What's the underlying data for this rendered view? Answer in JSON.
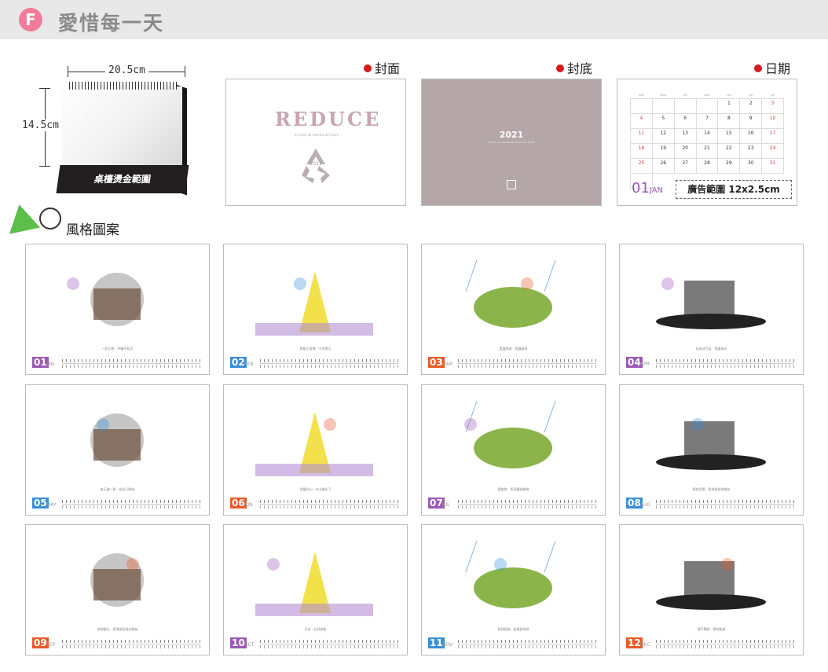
{
  "header": {
    "badge": "F",
    "title": "愛惜每一天"
  },
  "desk": {
    "width_label": "20.5cm",
    "height_label": "14.5cm",
    "base_label": "桌檯燙金範圍"
  },
  "sections": {
    "cover": "封面",
    "back": "封底",
    "date": "日期"
  },
  "cover": {
    "word": "REDUCE",
    "sub": "all days all months all years",
    "year": "2021"
  },
  "back": {
    "year": "2021",
    "line": "protect our planet earth our only home"
  },
  "date_page": {
    "weekdays": [
      "SUN",
      "MON",
      "TUE",
      "WED",
      "THU",
      "FRI",
      "SAT"
    ],
    "days": [
      "",
      "",
      "",
      "",
      "1",
      "2",
      "3",
      "4",
      "5",
      "6",
      "7",
      "8",
      "9",
      "10",
      "11",
      "12",
      "13",
      "14",
      "15",
      "16",
      "17",
      "18",
      "19",
      "20",
      "21",
      "22",
      "23",
      "24",
      "25",
      "26",
      "27",
      "28",
      "29",
      "30",
      "31",
      ""
    ],
    "month_num": "01",
    "month_name": "JAN",
    "ad_label": "廣告範圍 12x2.5cm"
  },
  "style_label": "風格圖案",
  "colors": {
    "accent_pink": "#f07b9a",
    "dot_red": "#d71920",
    "back_bg": "#b5a7a8",
    "tri_green": "#5bbf4a"
  },
  "months": [
    {
      "num": "01",
      "name": "JAN",
      "color": "#9b59b6",
      "caption": "一粒回收 · 杯罐不亂丟",
      "icon": "trash-pile-icon"
    },
    {
      "num": "02",
      "name": "FEB",
      "color": "#3a8fd6",
      "caption": "節能小習慣 · 不浪費水",
      "icon": "factory-tower-icon"
    },
    {
      "num": "03",
      "name": "MAR",
      "color": "#e85a2a",
      "caption": "愛護地球 · 愛護森林",
      "icon": "hill-rain-icon"
    },
    {
      "num": "04",
      "name": "APR",
      "color": "#9b59b6",
      "caption": "拒絕油污染 · 保護海洋",
      "icon": "oil-barrel-icon"
    },
    {
      "num": "05",
      "name": "MAY",
      "color": "#3a8fd6",
      "caption": "每天做一點 · 從自己開始",
      "icon": "faces-week-icon"
    },
    {
      "num": "06",
      "name": "JUN",
      "color": "#e85a2a",
      "caption": "保護冰山 · 冰山融化了",
      "icon": "pan-iceberg-icon"
    },
    {
      "num": "07",
      "name": "JUL",
      "color": "#9b59b6",
      "caption": "愛動物 · 別再獵殺動物",
      "icon": "bear-sign-icon"
    },
    {
      "num": "08",
      "name": "AUG",
      "color": "#3a8fd6",
      "caption": "節約用電 · 愛地球從你開始",
      "icon": "bulb-doodle-icon"
    },
    {
      "num": "09",
      "name": "SEP",
      "color": "#e85a2a",
      "caption": "地球暖化 · 愛地球從現在開始",
      "icon": "globe-shower-icon"
    },
    {
      "num": "10",
      "name": "OCT",
      "color": "#9b59b6",
      "caption": "反核 · 反對核能",
      "icon": "radiation-icon"
    },
    {
      "num": "11",
      "name": "NOV",
      "color": "#3a8fd6",
      "caption": "拔掉插頭 · 省電愛地球",
      "icon": "plug-socket-icon"
    },
    {
      "num": "12",
      "name": "DEC",
      "color": "#e85a2a",
      "caption": "隨手關燈 · 節約能源",
      "icon": "light-switch-icon"
    }
  ]
}
